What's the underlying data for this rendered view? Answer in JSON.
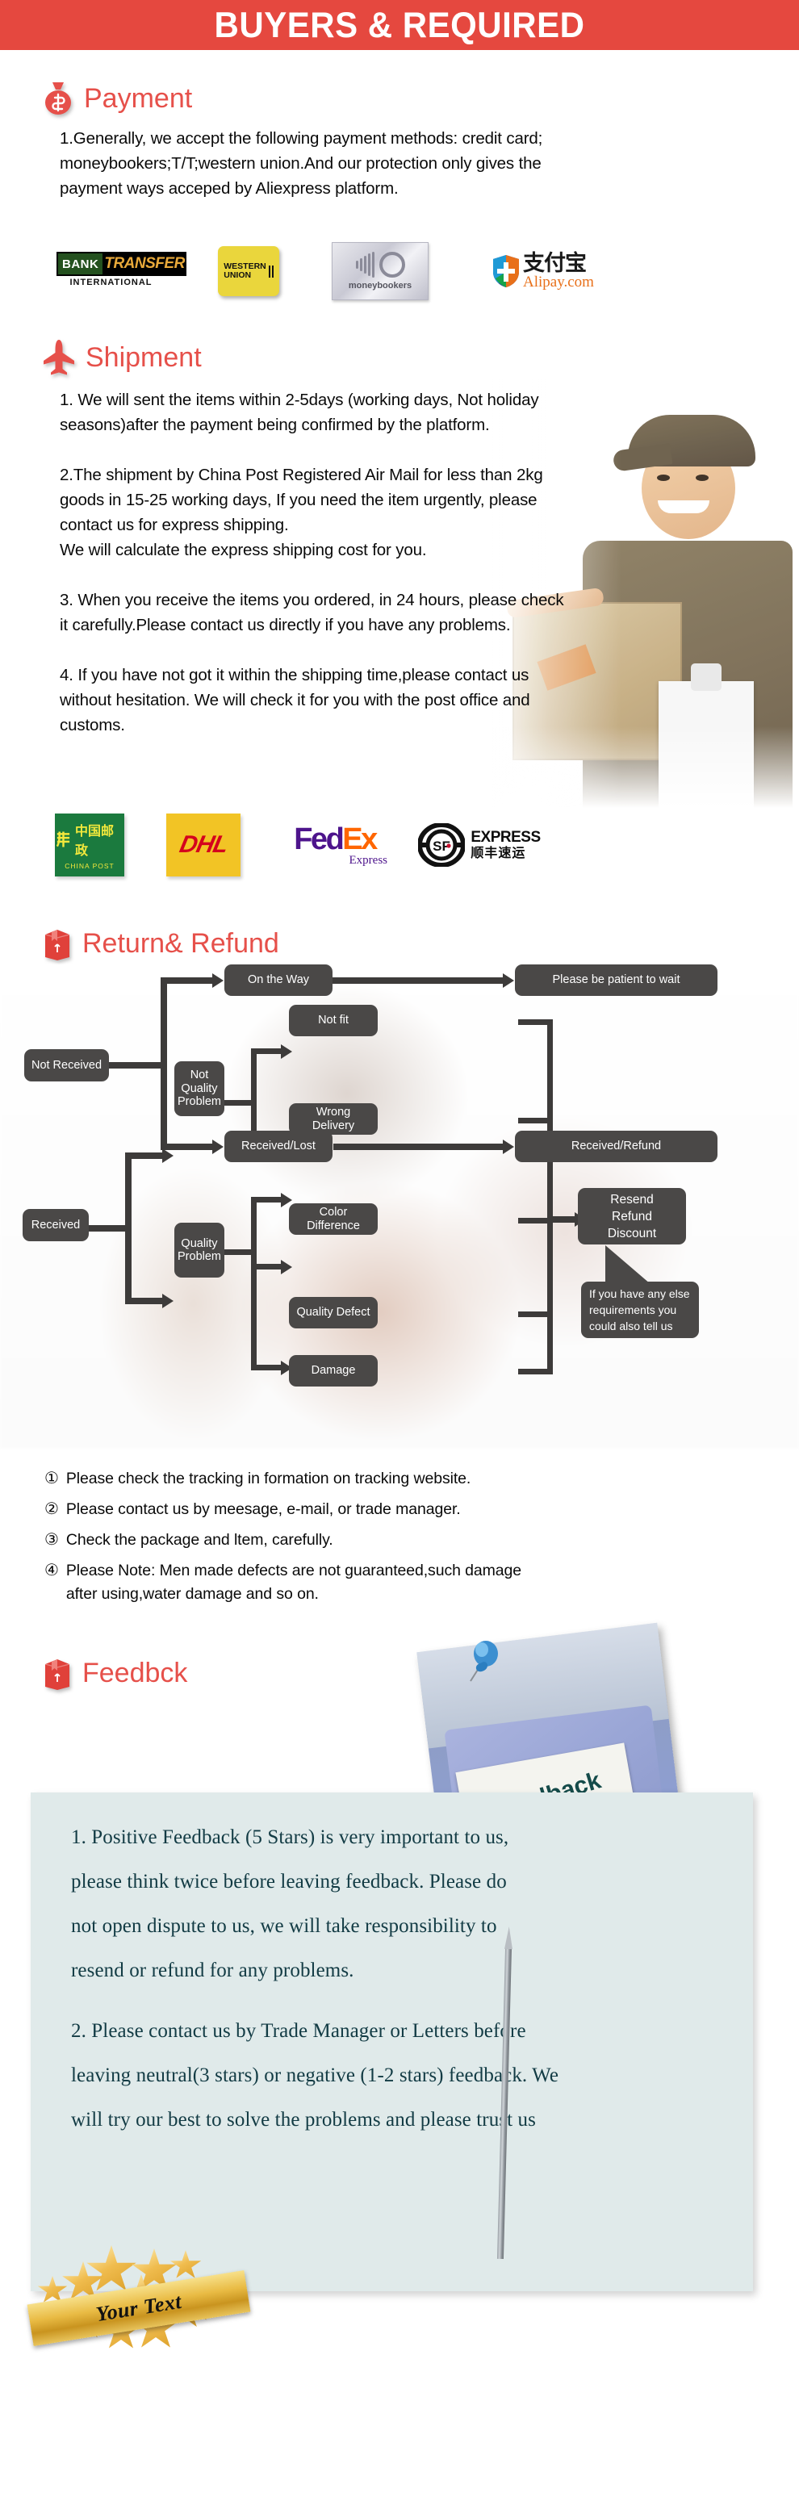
{
  "header": {
    "title": "BUYERS & REQUIRED"
  },
  "sections": {
    "payment": {
      "icon": "money-bag-icon",
      "heading": "Payment",
      "body": "1.Generally, we accept the following payment methods: credit card;\nmoneybookers;T/T;western union.And our protection only gives the\npayment ways acceped by Aliexpress platform.",
      "logos": [
        {
          "name": "bank-transfer-logo",
          "line1": "BANK",
          "line2": "TRANSFER",
          "line3": "INTERNATIONAL"
        },
        {
          "name": "western-union-logo",
          "line1": "WESTERN",
          "line2": "UNION"
        },
        {
          "name": "moneybookers-logo",
          "line1": "moneybookers"
        },
        {
          "name": "alipay-logo",
          "line1": "支付宝",
          "line2": "Alipay.com"
        }
      ]
    },
    "shipment": {
      "icon": "airplane-icon",
      "heading": "Shipment",
      "body": "1. We will sent the items within 2-5days (working days, Not holiday\nseasons)after the payment being confirmed by the platform.\n\n2.The shipment by China Post Registered Air Mail for less than  2kg\ngoods in 15-25 working days, If  you need the item urgently, please\ncontact us for express shipping.\nWe will calculate the express shipping cost for you.\n\n3. When you receive the items you ordered, in 24 hours, please check\n it carefully.Please contact us directly if you have any problems.\n\n4. If you have not got it within the shipping time,please contact us\nwithout hesitation. We will check it for you with the post office and\ncustoms.",
      "logos": [
        {
          "name": "china-post-logo",
          "line1": "中国邮政",
          "line2": "CHINA POST"
        },
        {
          "name": "dhl-logo",
          "line1": "DHL"
        },
        {
          "name": "fedex-logo",
          "line1": "Fed",
          "line2": "Ex",
          "line3": "Express"
        },
        {
          "name": "sf-express-logo",
          "line1": "SF",
          "line2": "EXPRESS",
          "line3": "顺丰速运"
        }
      ]
    },
    "return_refund": {
      "icon": "carton-box-icon",
      "heading": "Return& Refund",
      "flowchart": {
        "nodes": [
          {
            "id": "not-received",
            "label": "Not Received"
          },
          {
            "id": "on-the-way",
            "label": "On the Way"
          },
          {
            "id": "please-be-patient",
            "label": "Please be patient to wait"
          },
          {
            "id": "received-lost",
            "label": "Received/Lost"
          },
          {
            "id": "received-refund",
            "label": "Received/Refund"
          },
          {
            "id": "received",
            "label": "Received"
          },
          {
            "id": "not-quality-problem",
            "label": "Not\nQuality\nProblem"
          },
          {
            "id": "quality-problem",
            "label": "Quality\nProblem"
          },
          {
            "id": "not-fit",
            "label": "Not fit"
          },
          {
            "id": "wrong-delivery",
            "label": "Wrong Delivery"
          },
          {
            "id": "color-difference",
            "label": "Color Difference"
          },
          {
            "id": "quality-defect",
            "label": "Quality Defect"
          },
          {
            "id": "damage",
            "label": "Damage"
          },
          {
            "id": "resend-refund-discount",
            "label": "Resend\nRefund\nDiscount"
          },
          {
            "id": "any-else-requirements",
            "label": "If you have any else\nrequirements you\ncould also tell us"
          }
        ]
      },
      "notes": [
        {
          "num": "①",
          "text": "Please check the tracking in formation on tracking website."
        },
        {
          "num": "②",
          "text": "Please contact us by meesage, e-mail, or trade manager."
        },
        {
          "num": "③",
          "text": "Check the package and ltem, carefully."
        },
        {
          "num": "④",
          "text": "Please Note: Men made defects  are not guaranteed,such damage\n   after using,water damage and so on."
        }
      ]
    },
    "feedback": {
      "icon": "carton-box-icon",
      "heading": "Feedbck",
      "photo_sign_text": "Feedback",
      "paragraph_1": "1. Positive Feedback (5 Stars) is very important to us,\nplease think twice before leaving feedback. Please do\nnot open dispute to us,   we will take responsibility to\nresend or refund for any problems.",
      "paragraph_2": "2. Please contact us by Trade Manager or Letters before\nleaving neutral(3 stars) or negative (1-2 stars) feedback. We\nwill try our best to solve the problems and please trust us",
      "badge_text": "Your Text"
    }
  },
  "colors": {
    "header_red": "#e5483f",
    "heading_red": "#e6504a",
    "node_gray": "#4a4847",
    "feedback_panel": "#e0eaea",
    "feedback_text": "#123b44"
  }
}
